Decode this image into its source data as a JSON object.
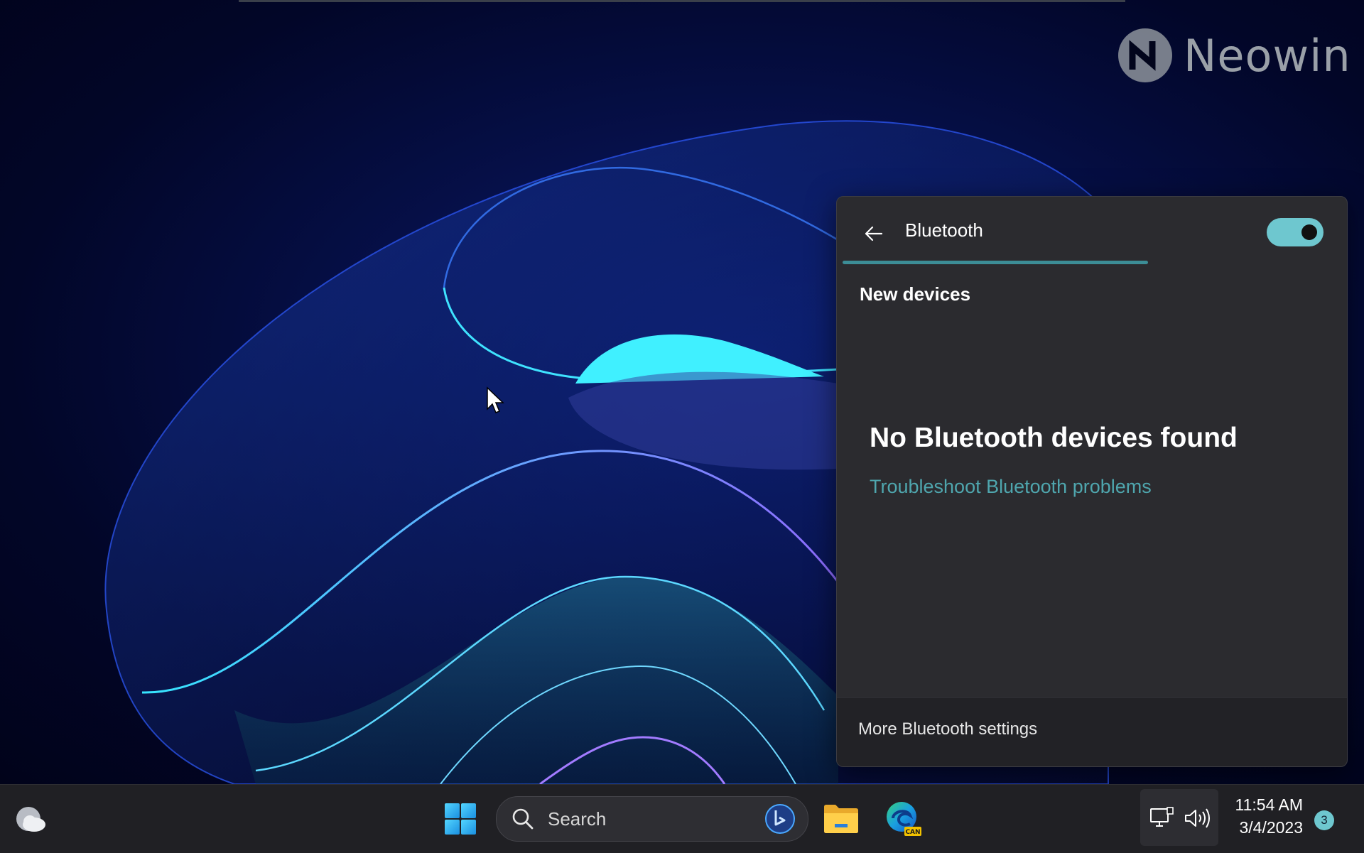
{
  "wallpaper": {
    "watermark": "Neowin"
  },
  "bluetooth_flyout": {
    "title": "Bluetooth",
    "toggle_state": "on",
    "scan_progress": 0.6,
    "section_heading": "New devices",
    "empty_message": "No Bluetooth devices found",
    "troubleshoot_link": "Troubleshoot Bluetooth problems",
    "footer_link": "More Bluetooth settings",
    "accent_color": "#6ec7cf"
  },
  "taskbar": {
    "search_placeholder": "Search",
    "edge_badge": "CAN",
    "clock_time": "11:54 AM",
    "clock_date": "3/4/2023",
    "notification_count": "3",
    "icons": [
      "weather-icon",
      "windows-logo-icon",
      "search-icon",
      "bing-icon",
      "file-explorer-icon",
      "edge-icon",
      "network-icon",
      "volume-icon"
    ]
  }
}
